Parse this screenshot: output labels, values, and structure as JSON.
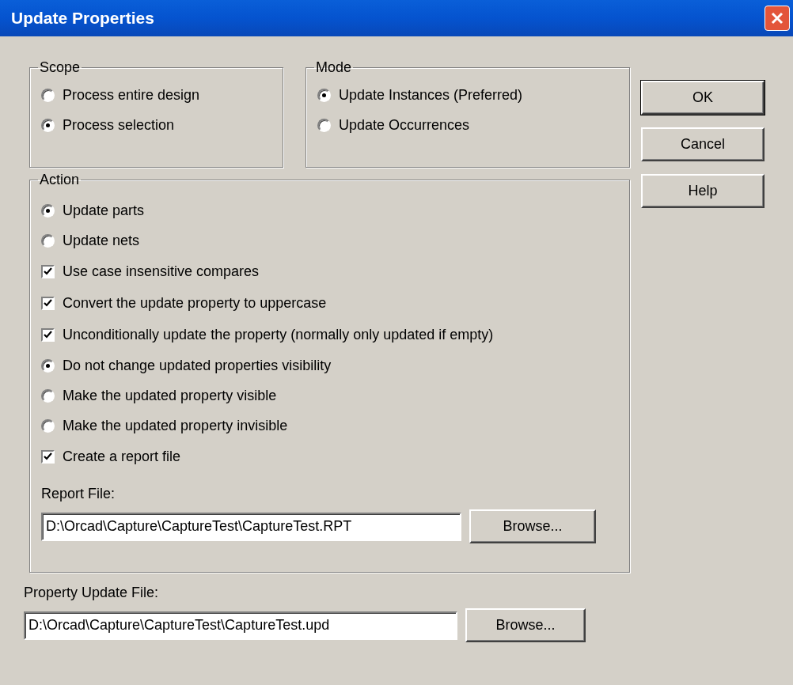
{
  "window": {
    "title": "Update Properties"
  },
  "scope": {
    "label": "Scope",
    "options": [
      {
        "label": "Process entire design",
        "selected": false
      },
      {
        "label": "Process selection",
        "selected": true
      }
    ]
  },
  "mode": {
    "label": "Mode",
    "options": [
      {
        "label": "Update Instances (Preferred)",
        "selected": true
      },
      {
        "label": "Update Occurrences",
        "selected": false
      }
    ]
  },
  "action": {
    "label": "Action",
    "items": [
      {
        "kind": "radio",
        "label": "Update parts",
        "selected": true
      },
      {
        "kind": "radio",
        "label": "Update nets",
        "selected": false
      },
      {
        "kind": "checkbox",
        "label": "Use case insensitive compares",
        "checked": true
      },
      {
        "kind": "checkbox",
        "label": "Convert the update property to uppercase",
        "checked": true
      },
      {
        "kind": "checkbox",
        "label": "Unconditionally update the property (normally only updated if empty)",
        "checked": true
      },
      {
        "kind": "radio",
        "label": "Do not change updated properties visibility",
        "selected": true
      },
      {
        "kind": "radio",
        "label": "Make the updated property visible",
        "selected": false
      },
      {
        "kind": "radio",
        "label": "Make the updated property invisible",
        "selected": false
      },
      {
        "kind": "checkbox",
        "label": "Create a report file",
        "checked": true
      }
    ],
    "report_file": {
      "label": "Report File:",
      "value": "D:\\Orcad\\Capture\\CaptureTest\\CaptureTest.RPT",
      "browse": "Browse..."
    }
  },
  "property_update_file": {
    "label": "Property Update File:",
    "value": "D:\\Orcad\\Capture\\CaptureTest\\CaptureTest.upd",
    "browse": "Browse..."
  },
  "buttons": [
    {
      "label": "OK",
      "default": true
    },
    {
      "label": "Cancel",
      "default": false
    },
    {
      "label": "Help",
      "default": false
    }
  ]
}
